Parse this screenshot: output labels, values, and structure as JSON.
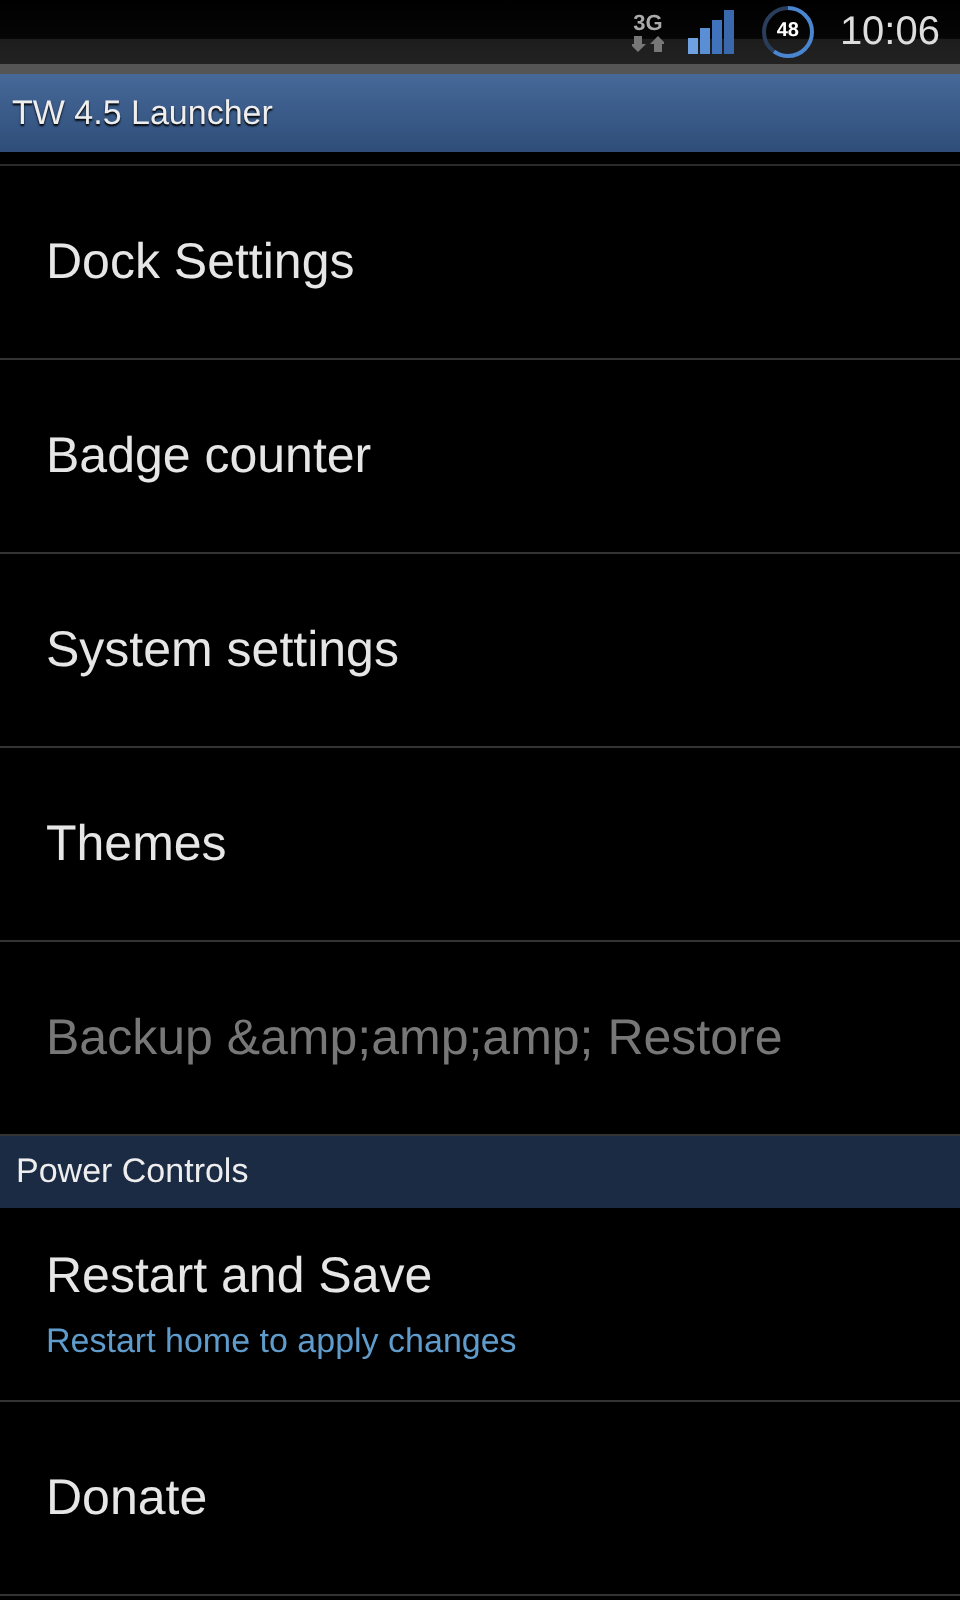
{
  "status_bar": {
    "network": "3G",
    "battery": "48",
    "time": "10:06"
  },
  "title": "TW 4.5 Launcher",
  "sections": [
    {
      "items": [
        {
          "title": "Dock Settings",
          "disabled": false
        },
        {
          "title": "Badge counter",
          "disabled": false
        },
        {
          "title": "System settings",
          "disabled": false
        },
        {
          "title": "Themes",
          "disabled": false
        },
        {
          "title": "Backup &amp;amp;amp; Restore",
          "disabled": true
        }
      ]
    },
    {
      "header": "Power Controls",
      "items": [
        {
          "title": "Restart and Save",
          "summary": "Restart home to apply changes",
          "disabled": false
        },
        {
          "title": "Donate",
          "disabled": false
        }
      ]
    }
  ]
}
